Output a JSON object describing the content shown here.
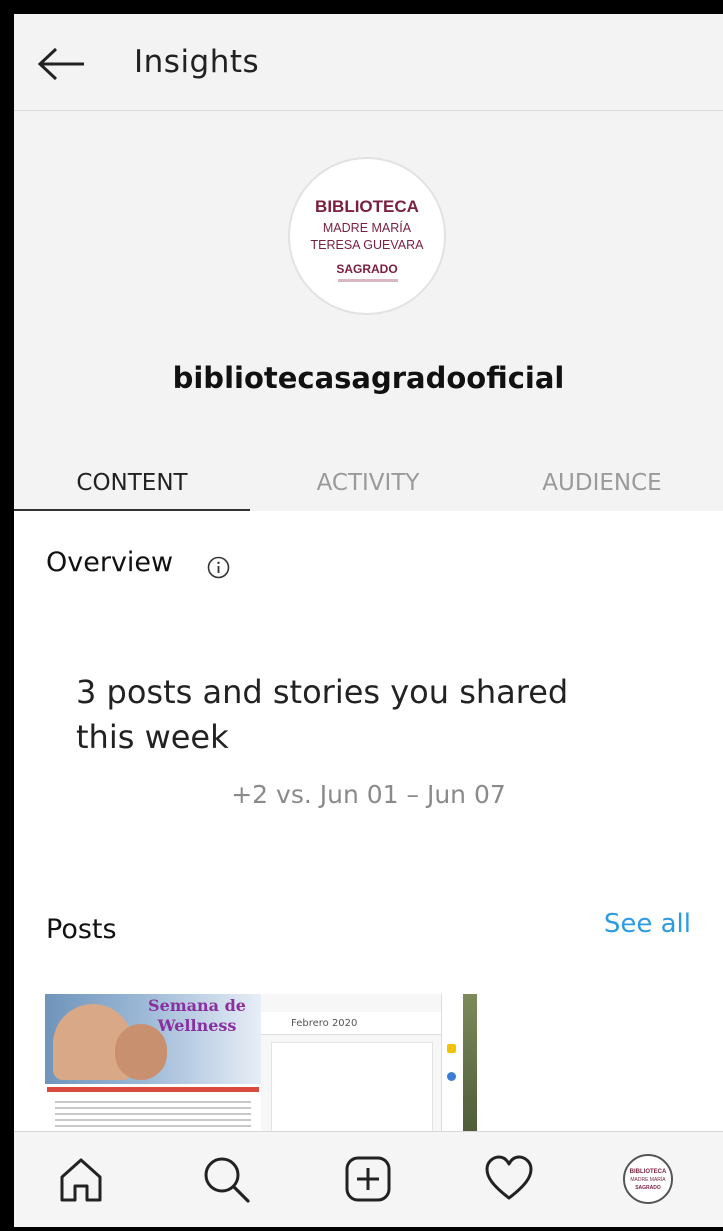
{
  "header": {
    "title": "Insights",
    "back_icon": "arrow-left-icon"
  },
  "profile": {
    "logo": {
      "line1": "BIBLIOTECA",
      "line2": "MADRE MARÍA",
      "line3": "TERESA GUEVARA",
      "line4": "SAGRADO"
    },
    "username": "bibliotecasagradooficial"
  },
  "tabs": [
    {
      "label": "CONTENT",
      "active": true
    },
    {
      "label": "ACTIVITY",
      "active": false
    },
    {
      "label": "AUDIENCE",
      "active": false
    }
  ],
  "overview": {
    "title": "Overview",
    "info_icon": "info-icon",
    "summary": "3 posts and stories you shared this week",
    "comparison": "+2 vs. Jun 01 – Jun 07"
  },
  "posts": {
    "title": "Posts",
    "see_all": "See all",
    "thumbnails": [
      {
        "line1": "Semana de",
        "line2": "Wellness"
      },
      {
        "toolbar_text": "Febrero 2020"
      }
    ]
  },
  "bottom_nav": {
    "items": [
      "home-icon",
      "search-icon",
      "add-post-icon",
      "heart-icon",
      "profile-avatar"
    ]
  },
  "colors": {
    "accent": "#2d9be0",
    "brand": "#7a1f3d"
  }
}
